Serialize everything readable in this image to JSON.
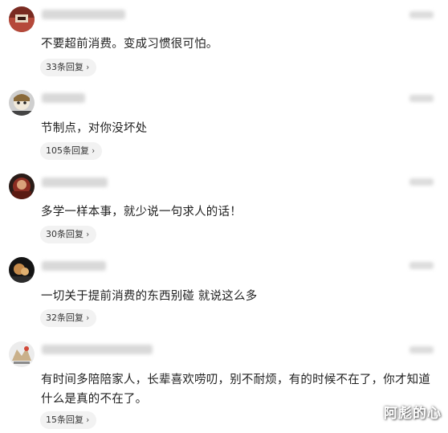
{
  "comments": [
    {
      "text": "不要超前消费。变成习惯很可怕。",
      "reply_label": "33条回复"
    },
    {
      "text": "节制点，对你没坏处",
      "reply_label": "105条回复"
    },
    {
      "text": "多学一样本事，就少说一句求人的话！",
      "reply_label": "30条回复"
    },
    {
      "text": "一切关于提前消费的东西别碰 就说这么多",
      "reply_label": "32条回复"
    },
    {
      "text": "有时间多陪陪家人，长辈喜欢唠叨，别不耐烦，有的时候不在了，你才知道什么是真的不在了。",
      "reply_label": "15条回复"
    }
  ],
  "reply_chevron": "›",
  "watermark": "阿彪的心",
  "colors": {
    "reply_bg": "#f2f2f2",
    "text": "#1f1f1f",
    "blur_placeholder": "#d9d9d9"
  }
}
